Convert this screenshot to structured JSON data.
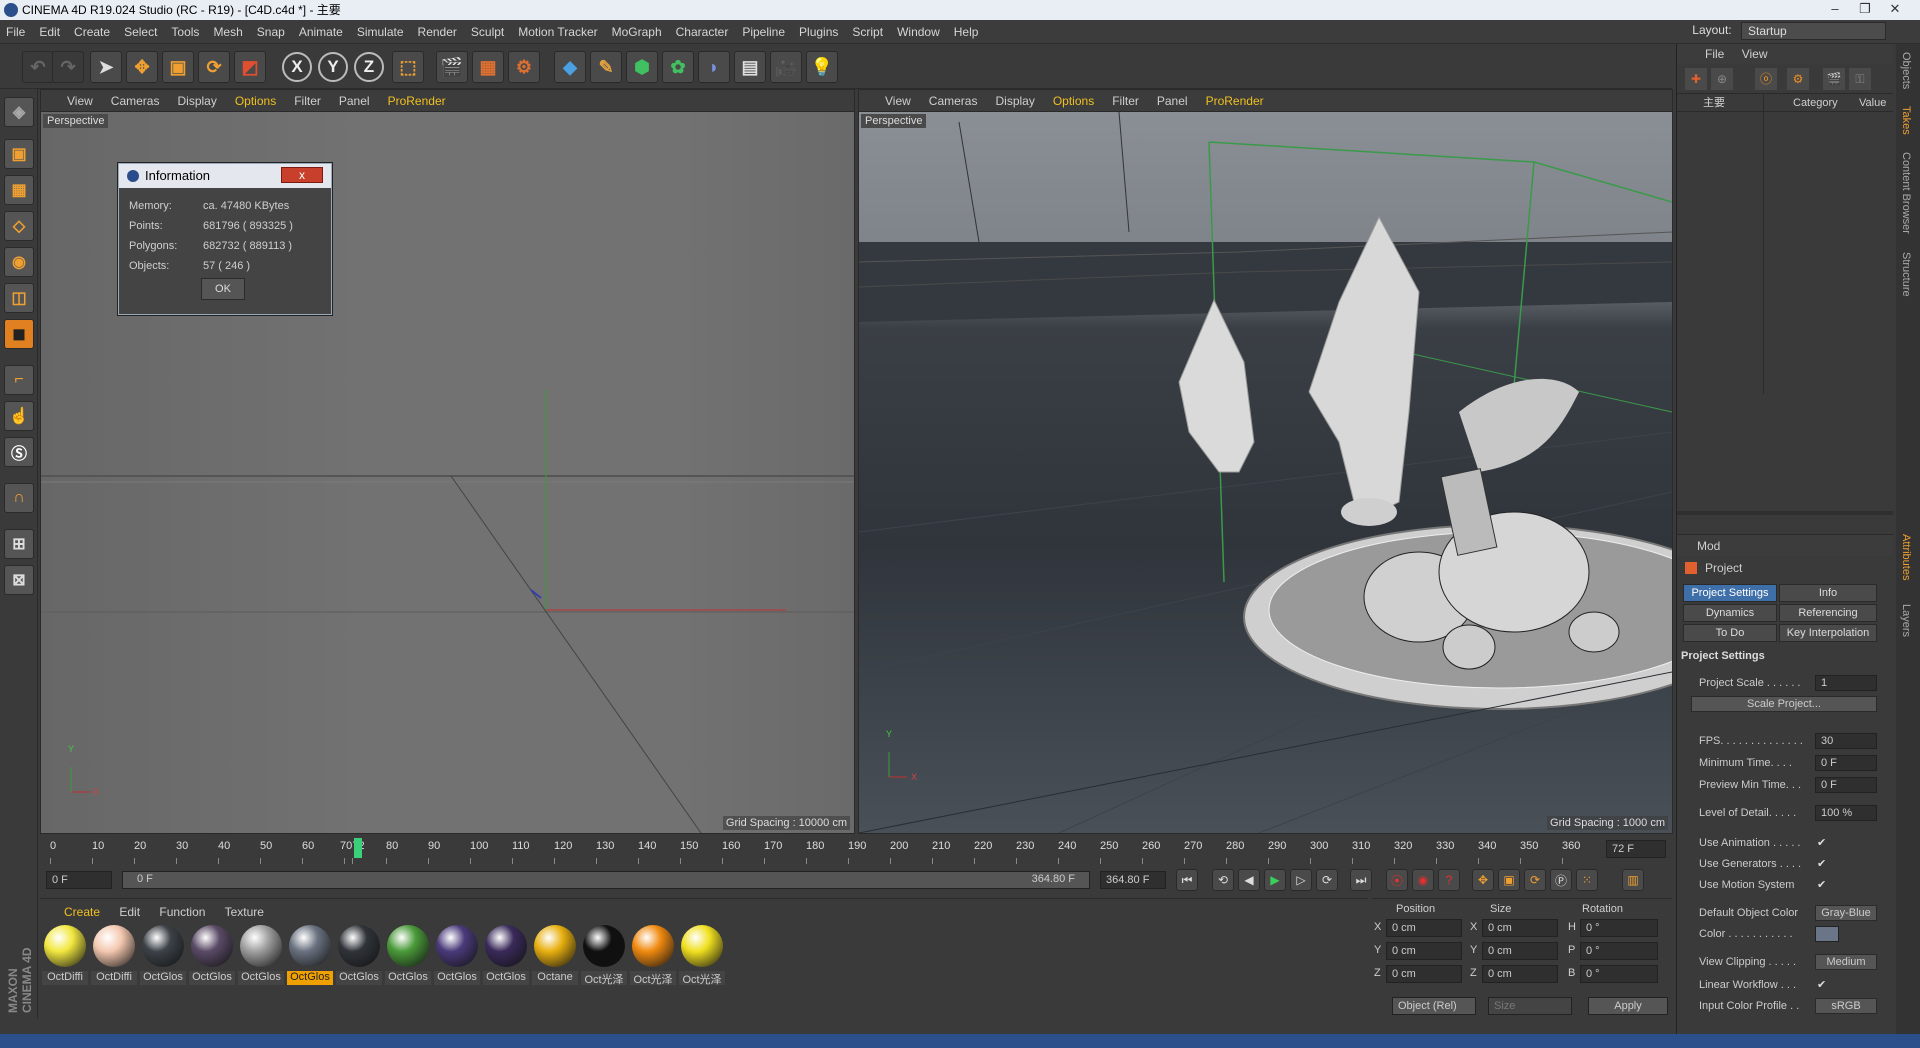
{
  "window": {
    "title": "CINEMA 4D R19.024 Studio (RC - R19) - [C4D.c4d *] - 主要"
  },
  "menu": [
    "File",
    "Edit",
    "Create",
    "Select",
    "Tools",
    "Mesh",
    "Snap",
    "Animate",
    "Simulate",
    "Render",
    "Sculpt",
    "Motion Tracker",
    "MoGraph",
    "Character",
    "Pipeline",
    "Plugins",
    "Script",
    "Window",
    "Help"
  ],
  "layout": {
    "label": "Layout:",
    "value": "Startup"
  },
  "toolbar": {
    "x": "X",
    "y": "Y",
    "z": "Z"
  },
  "viewport_menu": [
    "View",
    "Cameras",
    "Display",
    "Options",
    "Filter",
    "Panel",
    "ProRender"
  ],
  "viewport_left": {
    "label": "Perspective",
    "grid": "Grid Spacing : 10000 cm"
  },
  "viewport_right": {
    "label": "Perspective",
    "grid": "Grid Spacing : 1000 cm"
  },
  "axis": {
    "x": "X",
    "y": "Y"
  },
  "info_dialog": {
    "title": "Information",
    "close": "x",
    "rows": [
      {
        "label": "Memory:",
        "value": "ca. 47480 KBytes"
      },
      {
        "label": "Points:",
        "value": "681796 ( 893325 )"
      },
      {
        "label": "Polygons:",
        "value": "682732 ( 889113 )"
      },
      {
        "label": "Objects:",
        "value": "57 ( 246 )"
      }
    ],
    "ok": "OK"
  },
  "timeline": {
    "ticks": [
      "0",
      "10",
      "20",
      "30",
      "40",
      "50",
      "60",
      "70",
      "72",
      "80",
      "90",
      "100",
      "110",
      "120",
      "130",
      "140",
      "150",
      "160",
      "170",
      "180",
      "190",
      "200",
      "210",
      "220",
      "230",
      "240",
      "250",
      "260",
      "270",
      "280",
      "290",
      "300",
      "310",
      "320",
      "330",
      "340",
      "350",
      "360"
    ],
    "current_frame": "72 F",
    "start": "0 F",
    "range_start": "0 F",
    "range_end": "364.80 F",
    "end": "364.80 F"
  },
  "materials": {
    "menu": [
      "Create",
      "Edit",
      "Function",
      "Texture"
    ],
    "items": [
      {
        "name": "OctDiffi",
        "color": "#f2e840"
      },
      {
        "name": "OctDiffi",
        "color": "#f4c8b0"
      },
      {
        "name": "OctGlos",
        "color": "#3c4248"
      },
      {
        "name": "OctGlos",
        "color": "#5a4a66"
      },
      {
        "name": "OctGlos",
        "color": "#a0a0a0"
      },
      {
        "name": "OctGlos",
        "color": "#6a7280",
        "selected": true
      },
      {
        "name": "OctGlos",
        "color": "#30343a"
      },
      {
        "name": "OctGlos",
        "color": "#4a9a3a"
      },
      {
        "name": "OctGlos",
        "color": "#4a3a7a"
      },
      {
        "name": "OctGlos",
        "color": "#3a2a5a"
      },
      {
        "name": "Octane",
        "color": "#e8b010"
      },
      {
        "name": "Oct光泽",
        "color": "#101010"
      },
      {
        "name": "Oct光泽",
        "color": "#f08a10"
      },
      {
        "name": "Oct光泽",
        "color": "#f0e020"
      }
    ]
  },
  "coords": {
    "headers": [
      "Position",
      "Size",
      "Rotation"
    ],
    "rows": [
      {
        "a": "X",
        "pos": "0 cm",
        "b": "X",
        "size": "0 cm",
        "c": "H",
        "rot": "0 °"
      },
      {
        "a": "Y",
        "pos": "0 cm",
        "b": "Y",
        "size": "0 cm",
        "c": "P",
        "rot": "0 °"
      },
      {
        "a": "Z",
        "pos": "0 cm",
        "b": "Z",
        "size": "0 cm",
        "c": "B",
        "rot": "0 °"
      }
    ],
    "mode": "Object (Rel)",
    "size_mode": "Size",
    "apply": "Apply"
  },
  "objects_panel": {
    "menu": [
      "File",
      "View"
    ],
    "root": "主要",
    "columns": [
      "Category",
      "Value"
    ]
  },
  "attributes": {
    "mode": "Mod",
    "title": "Project",
    "tabs": [
      {
        "label": "Project Settings",
        "active": true
      },
      {
        "label": "Info"
      },
      {
        "label": "Dynamics"
      },
      {
        "label": "Referencing"
      },
      {
        "label": "To Do"
      },
      {
        "label": "Key Interpolation"
      }
    ],
    "section": "Project Settings",
    "fields": [
      {
        "label": "Project Scale . . . . . .",
        "value": "1",
        "kind": "val"
      },
      {
        "label": "",
        "value": "Scale Project...",
        "kind": "wide"
      },
      {
        "label": "FPS. . . . . . . . . . . . . .",
        "value": "30",
        "kind": "val"
      },
      {
        "label": "Minimum Time. . . .",
        "value": "0 F",
        "kind": "val"
      },
      {
        "label": "Preview Min Time. . .",
        "value": "0 F",
        "kind": "val"
      },
      {
        "label": "Level of Detail. . . . .",
        "value": "100 %",
        "kind": "val"
      },
      {
        "label": "Use Animation . . . . .",
        "value": "✔",
        "kind": "chk"
      },
      {
        "label": "Use Generators . . . .",
        "value": "✔",
        "kind": "chk"
      },
      {
        "label": "Use Motion System",
        "value": "✔",
        "kind": "chk"
      },
      {
        "label": "Default Object Color",
        "value": "Gray-Blue",
        "kind": "btn"
      },
      {
        "label": "Color . . . . . . . . . . .",
        "value": "",
        "kind": "swatch"
      },
      {
        "label": "View Clipping . . . . .",
        "value": "Medium",
        "kind": "btn"
      },
      {
        "label": "Linear Workflow . . .",
        "value": "✔",
        "kind": "chk"
      },
      {
        "label": "Input Color Profile . .",
        "value": "sRGB",
        "kind": "btn"
      }
    ]
  },
  "side_tabs": [
    "Objects",
    "Takes",
    "Content Browser",
    "Structure",
    "Attributes",
    "Layers"
  ],
  "brand": "MAXON CINEMA 4D"
}
